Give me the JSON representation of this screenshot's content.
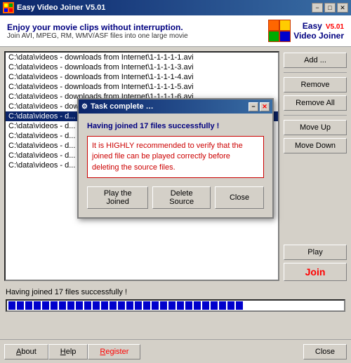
{
  "window": {
    "title": "Easy Video Joiner  V5.01",
    "version": "V5.01",
    "min_label": "−",
    "max_label": "□",
    "close_label": "✕"
  },
  "header": {
    "tagline": "Enjoy your movie clips without interruption.",
    "subtitle": "Join AVI, MPEG, RM, WMV/ASF files into one large movie",
    "logo_version": "V5.01",
    "logo_line1": "Easy",
    "logo_line2": "Video Joiner"
  },
  "file_list": {
    "items": [
      "C:\\data\\videos - downloads from Internet\\1-1-1-1-1.avi",
      "C:\\data\\videos - downloads from Internet\\1-1-1-1-3.avi",
      "C:\\data\\videos - downloads from Internet\\1-1-1-1-4.avi",
      "C:\\data\\videos - downloads from Internet\\1-1-1-1-5.avi",
      "C:\\data\\videos - downloads from Internet\\1-1-1-1-6.avi",
      "C:\\data\\videos - downloads from Internet\\20M_(5).avi",
      "C:\\data\\videos - d...",
      "C:\\data\\videos - d...",
      "C:\\data\\videos - d...",
      "C:\\data\\videos - d...",
      "C:\\data\\videos - d...",
      "C:\\data\\videos - d..."
    ],
    "selected_index": 6
  },
  "buttons": {
    "add": "Add ...",
    "remove": "Remove",
    "remove_all": "Remove All",
    "move_up": "Move Up",
    "move_down": "Move Down",
    "play": "Play",
    "join": "Join"
  },
  "status": {
    "text": "Having joined 17 files successfully !",
    "progress_blocks": 28
  },
  "modal": {
    "title": "Task complete …",
    "minimize_label": "−",
    "close_label": "✕",
    "success_text": "Having joined 17 files successfully !",
    "warning_text": "It is HIGHLY recommended to verify that the joined file can be played correctly before deleting the source files.",
    "btn_play": "Play the Joined",
    "btn_delete": "Delete Source",
    "btn_close": "Close"
  },
  "bottom_bar": {
    "about": "About",
    "help": "Help",
    "register": "Register",
    "close": "Close"
  }
}
